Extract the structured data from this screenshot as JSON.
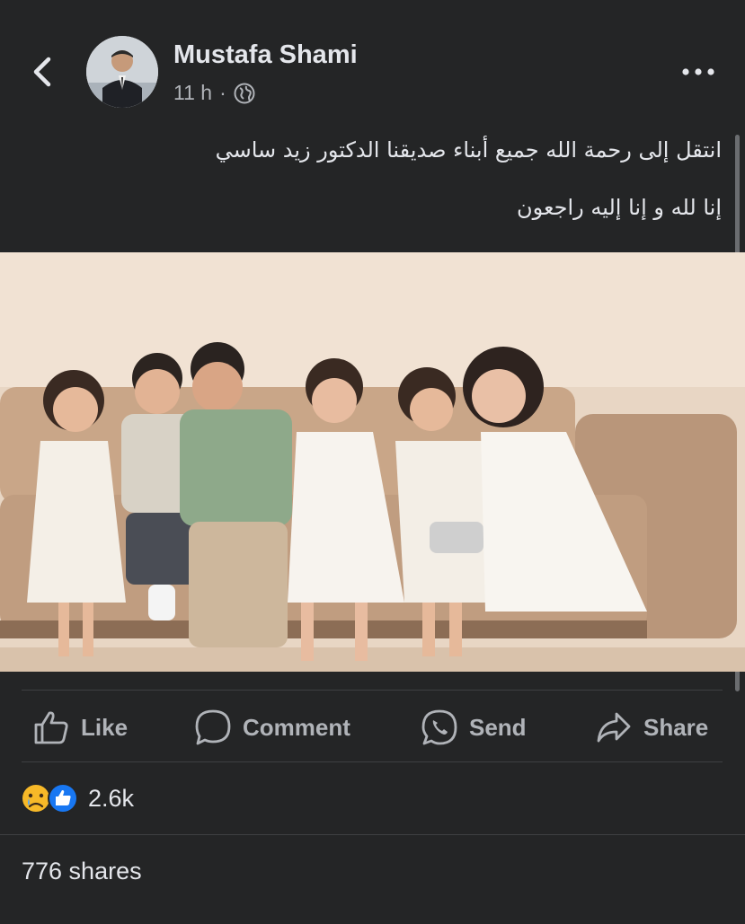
{
  "post": {
    "author": "Mustafa Shami",
    "time": "11 h",
    "separator": "·",
    "privacy_icon": "globe-icon",
    "text_line1": "انتقل إلى رحمة الله جميع أبناء صديقنا  الدكتور زيد ساسي",
    "text_line2": "إنا لله و إنا إليه راجعون"
  },
  "actions": {
    "like": "Like",
    "comment": "Comment",
    "send": "Send",
    "share": "Share"
  },
  "reactions": {
    "icons": [
      "sad-icon",
      "like-icon"
    ],
    "count": "2.6k"
  },
  "shares": "776 shares",
  "colors": {
    "background": "#242526",
    "text": "#e4e6eb",
    "secondary_text": "#b0b3b8",
    "like_blue": "#1877f2",
    "sad_yellow": "#f7b928"
  }
}
